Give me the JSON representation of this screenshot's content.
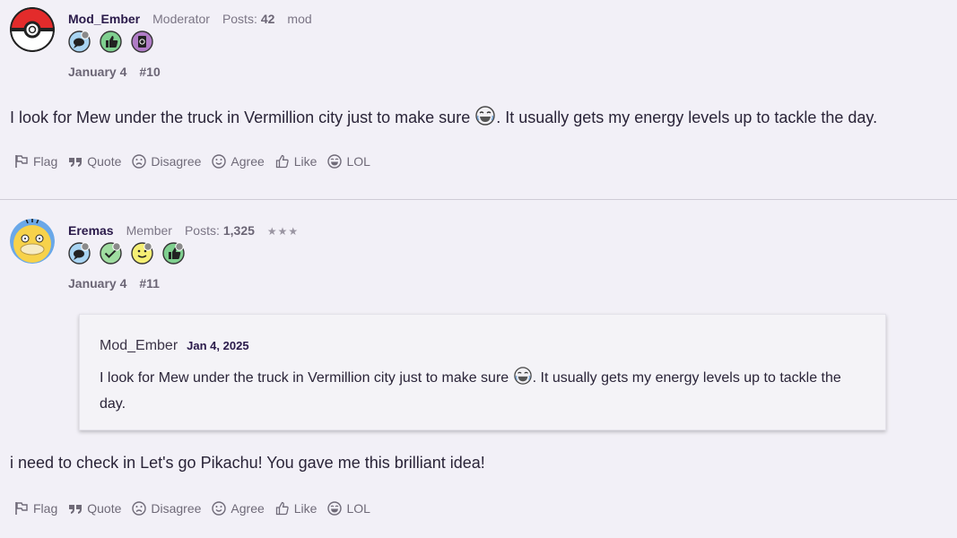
{
  "posts": [
    {
      "username": "Mod_Ember",
      "role": "Moderator",
      "posts_label": "Posts:",
      "posts_count": "42",
      "tag": "mod",
      "badge_icons": [
        "speech-bubble-icon",
        "thumbs-up-icon",
        "notebook-icon"
      ],
      "date": "January 4",
      "post_number": "#10",
      "text_before_emoji": "I look for Mew under the truck in Vermillion city just to make sure ",
      "emoji": "joy-emoji-icon",
      "text_after_emoji": ". It usually gets my energy levels up to tackle the day."
    },
    {
      "username": "Eremas",
      "role": "Member",
      "posts_label": "Posts:",
      "posts_count": "1,325",
      "stars": "★★★",
      "badge_icons": [
        "speech-bubble-icon",
        "checkmark-icon",
        "smiley-icon",
        "thumbs-up-icon"
      ],
      "date": "January 4",
      "post_number": "#11",
      "quote": {
        "author": "Mod_Ember",
        "date": "Jan 4, 2025",
        "text_before_emoji": "I look for Mew under the truck in Vermillion city just to make sure ",
        "emoji": "joy-emoji-icon",
        "text_after_emoji": ". It usually gets my energy levels up to tackle the day."
      },
      "text": "i need to check in Let's go Pikachu! You gave me this brilliant idea!"
    }
  ],
  "actions": {
    "flag": "Flag",
    "quote": "Quote",
    "disagree": "Disagree",
    "agree": "Agree",
    "like": "Like",
    "lol": "LOL"
  },
  "colors": {
    "background": "#f2f0f7",
    "username": "#2a1a4a",
    "muted": "#7b7585",
    "badge_blue": "#a8d4f2",
    "badge_green": "#7fcf8f",
    "badge_purple": "#b07cc6",
    "badge_yellow": "#f5ef74"
  }
}
